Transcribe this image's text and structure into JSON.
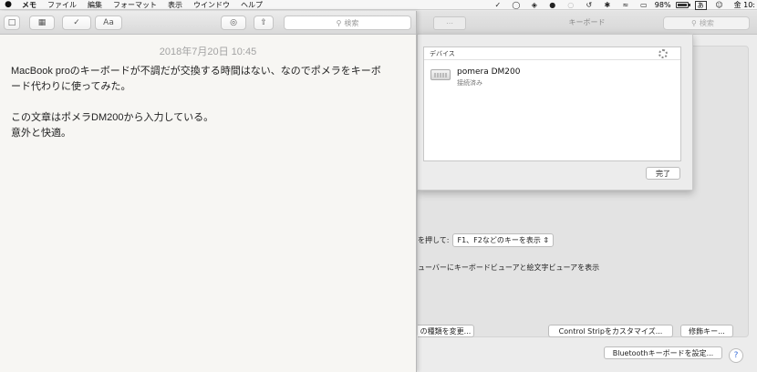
{
  "menubar": {
    "apple": "",
    "items": [
      "メモ",
      "ファイル",
      "編集",
      "フォーマット",
      "表示",
      "ウインドウ",
      "ヘルプ"
    ],
    "battery_percent": "98%",
    "battery_level": 0.98,
    "input_source": "あ",
    "clock": "金 10:"
  },
  "notes": {
    "toolbar": {
      "lock_icon": "lock-icon",
      "table_icon": "table-icon",
      "checklist_icon": "checklist-icon",
      "format_label": "Aa",
      "search_placeholder": "検索"
    },
    "date": "2018年7月20日 10:45",
    "lines": [
      "MacBook proのキーボードが不調だが交換する時間はない、なのでポメラをキーボ",
      "ード代わりに使ってみた。",
      "",
      "この文章はポメラDM200から入力している。",
      "意外と快適。"
    ]
  },
  "prefs": {
    "title": "キーボード",
    "search_placeholder": "検索",
    "fn_prefix": "を押して:",
    "fn_value": "F1、F2などのキーを表示",
    "viewer_text": "ューバーにキーボードビューアと絵文字ビューアを表示",
    "change_type_button": "の種類を変更...",
    "control_strip_button": "Control Stripをカスタマイズ...",
    "modifier_button": "修飾キー...",
    "bluetooth_button": "Bluetoothキーボードを設定...",
    "help": "?"
  },
  "sheet": {
    "header": "デバイス",
    "device_name": "pomera DM200",
    "device_status": "接続済み",
    "done_button": "完了"
  }
}
